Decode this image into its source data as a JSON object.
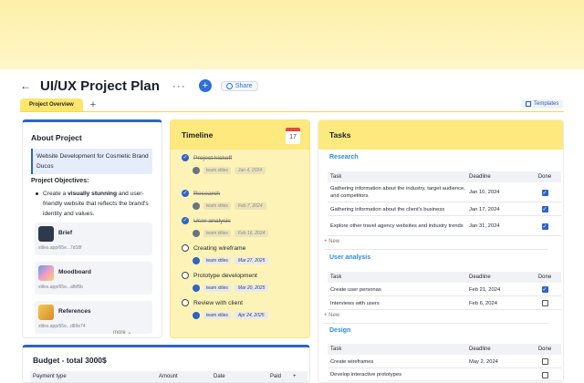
{
  "header": {
    "back_icon": "arrow-left-icon",
    "title": "UI/UX Project Plan",
    "more_label": "···",
    "add_label": "+",
    "share_label": "Share"
  },
  "tabs": [
    {
      "label": "Project Overview",
      "active": true
    }
  ],
  "tab_add_label": "+",
  "templates_label": "Templates",
  "about": {
    "title": "About Project",
    "description": "Website Development for Cosmetic Brand Ducos",
    "objectives_title": "Project Objectives:",
    "objective_pre": "Create a ",
    "objective_bold": "visually stunning",
    "objective_post": " and user-friendly website that reflects the brand's identity and values.",
    "files": [
      {
        "name": "Brief",
        "path": "xtiles.app/65e...7d18f"
      },
      {
        "name": "Moodboard",
        "path": "xtiles.app/65e...afbf5b"
      },
      {
        "name": "References",
        "path": "xtiles.app/65e...d89e74"
      }
    ]
  },
  "timeline": {
    "title": "Timeline",
    "calendar_day": "17",
    "more_label": "more",
    "items": [
      {
        "label": "Project kickoff",
        "done": true,
        "assignee": "team xtiles",
        "date": "Jan 4, 2024"
      },
      {
        "label": "Research",
        "done": true,
        "assignee": "team xtiles",
        "date": "Feb 7, 2024"
      },
      {
        "label": "User analysis",
        "done": true,
        "assignee": "team xtiles",
        "date": "Feb 16, 2024"
      },
      {
        "label": "Creating wireframe",
        "done": false,
        "assignee": "team xtiles",
        "date": "Mar 27, 2025"
      },
      {
        "label": "Prototype development",
        "done": false,
        "assignee": "team xtiles",
        "date": "Mar 20, 2025"
      },
      {
        "label": "Review with client",
        "done": false,
        "assignee": "team xtiles",
        "date": "Apr 24, 2025"
      }
    ]
  },
  "tasks": {
    "title": "Tasks",
    "columns": {
      "task": "Task",
      "deadline": "Deadline",
      "done": "Done"
    },
    "new_label": "New",
    "sections": [
      {
        "name": "Research",
        "rows": [
          {
            "task": "Gathering information about the industry, target audience, and competitors.",
            "deadline": "Jan 10, 2024",
            "done": true
          },
          {
            "task": "Gathering information about the client's business",
            "deadline": "Jan 17, 2024",
            "done": true
          },
          {
            "task": "Explore other travel agency websites and industry trends",
            "deadline": "Jan 31, 2024",
            "done": true
          }
        ]
      },
      {
        "name": "User analysis",
        "rows": [
          {
            "task": "Create user personas",
            "deadline": "Feb 21, 2024",
            "done": true
          },
          {
            "task": "Interviews with users",
            "deadline": "Feb 6, 2024",
            "done": false
          }
        ]
      },
      {
        "name": "Design",
        "rows": [
          {
            "task": "Create wireframes",
            "deadline": "May 2, 2024",
            "done": false
          },
          {
            "task": "Develop interactive prototypes",
            "deadline": "",
            "done": false
          }
        ]
      }
    ]
  },
  "budget": {
    "title": "Budget - total 3000$",
    "columns": {
      "payment_type": "Payment type",
      "amount": "Amount",
      "date": "Date",
      "paid": "Paid",
      "add": "+"
    }
  },
  "colors": {
    "accent": "#2e63c9",
    "banner": "#fdf0a8",
    "timeline_bg": "#fdf3b6",
    "section_title": "#2a8cd8"
  }
}
